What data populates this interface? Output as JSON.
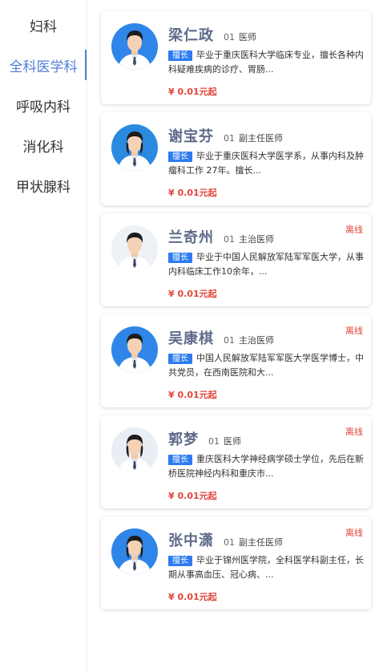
{
  "sidebar": {
    "items": [
      {
        "label": "妇科",
        "active": false
      },
      {
        "label": "全科医学科",
        "active": true
      },
      {
        "label": "呼吸内科",
        "active": false
      },
      {
        "label": "消化科",
        "active": false
      },
      {
        "label": "甲状腺科",
        "active": false
      }
    ]
  },
  "doctors": [
    {
      "name": "梁仁政",
      "num": "01",
      "title": "医师",
      "tag": "擅长",
      "desc": "毕业于重庆医科大学临床专业，擅长各种内科疑难疾病的诊疗、胃肠...",
      "price": "¥ 0.01元起",
      "status": "",
      "gender": "male",
      "coat": "white"
    },
    {
      "name": "谢宝芬",
      "num": "01",
      "title": "副主任医师",
      "tag": "擅长",
      "desc": "毕业于重庆医科大学医学系，从事内科及肿瘤科工作 27年。擅长...",
      "price": "¥ 0.01元起",
      "status": "",
      "gender": "female",
      "coat": "white"
    },
    {
      "name": "兰奇州",
      "num": "01",
      "title": "主治医师",
      "tag": "擅长",
      "desc": "毕业于中国人民解放军陆军军医大学，从事内科临床工作10余年，...",
      "price": "¥ 0.01元起",
      "status": "离线",
      "gender": "male",
      "coat": "white"
    },
    {
      "name": "吴康棋",
      "num": "01",
      "title": "主治医师",
      "tag": "擅长",
      "desc": "中国人民解放军陆军军医大学医学博士，中共党员，在西南医院和大...",
      "price": "¥ 0.01元起",
      "status": "离线",
      "gender": "male",
      "coat": "white"
    },
    {
      "name": "郭梦",
      "num": "01",
      "title": "医师",
      "tag": "擅长",
      "desc": "重庆医科大学神经病学硕士学位，先后在新桥医院神经内科和重庆市...",
      "price": "¥ 0.01元起",
      "status": "离线",
      "gender": "female",
      "coat": "white"
    },
    {
      "name": "张中潇",
      "num": "01",
      "title": "副主任医师",
      "tag": "擅长",
      "desc": "毕业于锦州医学院，全科医学科副主任，长期从事高血压、冠心病、...",
      "price": "¥ 0.01元起",
      "status": "离线",
      "gender": "female",
      "coat": "white"
    }
  ],
  "colors": {
    "accent": "#4f7ed9",
    "tag": "#2e7cf0",
    "price": "#e0463a",
    "name": "#5e6b8a"
  }
}
